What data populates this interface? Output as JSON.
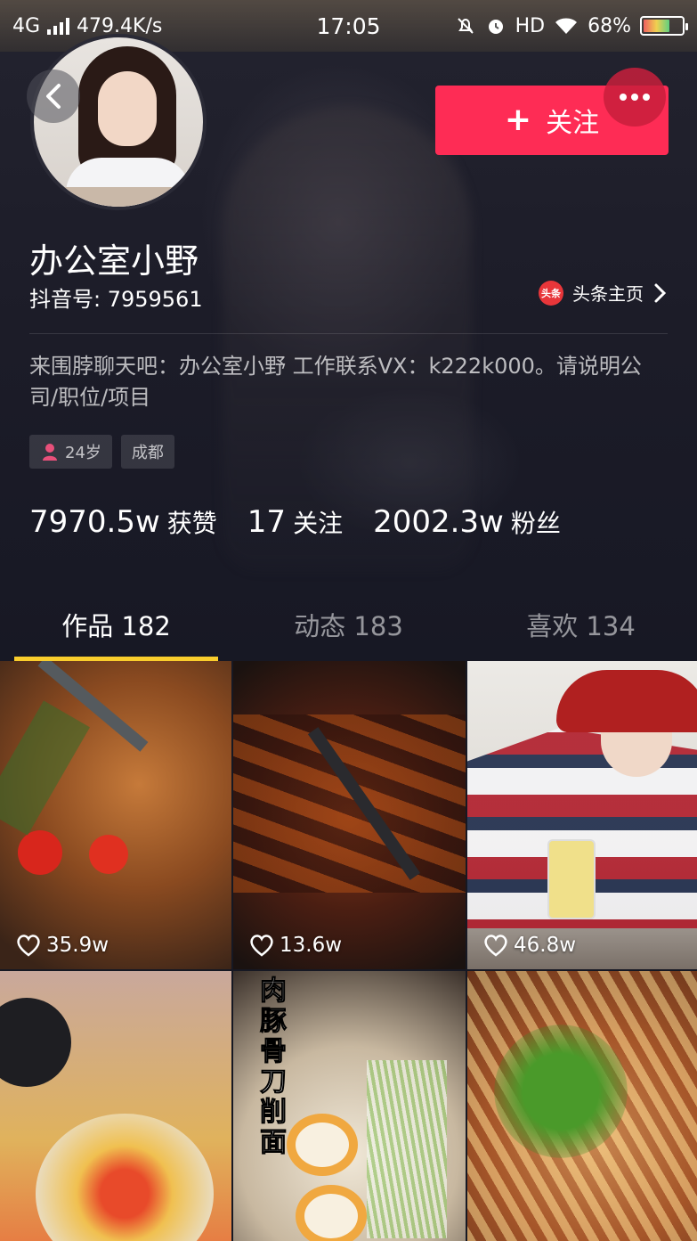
{
  "status_bar": {
    "network": "4G",
    "speed": "479.4K/s",
    "time": "17:05",
    "hd": "HD",
    "battery": "68%",
    "battery_level": 0.68
  },
  "header": {
    "follow_label": "关注",
    "follow_plus": "+"
  },
  "profile": {
    "name": "办公室小野",
    "douyin_id": "抖音号: 7959561",
    "toutiao_logo": "头条",
    "toutiao_label": "头条主页",
    "bio": "来围脖聊天吧：办公室小野 工作联系VX：k222k000。请说明公司/职位/项目",
    "tags": {
      "age": "24岁",
      "city": "成都"
    },
    "stats": [
      {
        "num": "7970.5w",
        "label": "获赞"
      },
      {
        "num": "17",
        "label": "关注"
      },
      {
        "num": "2002.3w",
        "label": "粉丝"
      }
    ]
  },
  "tabs": [
    {
      "label": "作品 182"
    },
    {
      "label": "动态 183"
    },
    {
      "label": "喜欢 134"
    }
  ],
  "videos": [
    {
      "likes": "35.9w"
    },
    {
      "likes": "13.6w"
    },
    {
      "likes": "46.8w"
    },
    {
      "likes": ""
    },
    {
      "likes": "",
      "overlay_text": "肉豚骨刀削面"
    },
    {
      "likes": ""
    }
  ],
  "colors": {
    "accent": "#fe2c55",
    "tab_indicator": "#facd2c",
    "background": "#161823"
  }
}
